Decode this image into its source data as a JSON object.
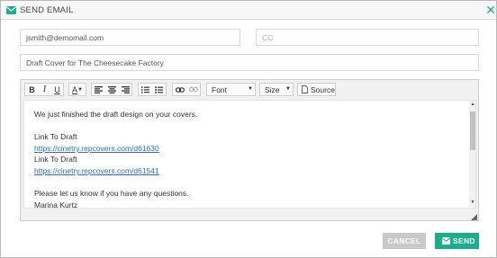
{
  "dialog": {
    "title": "SEND EMAIL",
    "close_glyph": "✕",
    "accent_color": "#1aaf8b",
    "title_icon": "envelope-icon"
  },
  "fields": {
    "to_value": "jsmith@demomail.com",
    "cc_placeholder": "CC",
    "subject_value": "Draft Cover for The Cheesecake Factory"
  },
  "toolbar": {
    "bold": "B",
    "italic": "I",
    "underline": "U",
    "font_color": "A",
    "font_label": "Font",
    "size_label": "Size",
    "source_label": "Source"
  },
  "body": {
    "line1": "We just finished the draft design on your covers.",
    "line2": "Link To Draft",
    "link1": "https://cinetry.repcovers.com/d61630",
    "line3": "Link To Draft",
    "link2": "https://cinetry.repcovers.com/d61541",
    "line4": "Please let us know if you have any questions.",
    "line5": "Marina Kurtz"
  },
  "buttons": {
    "cancel": "CANCEL",
    "send": "SEND"
  }
}
